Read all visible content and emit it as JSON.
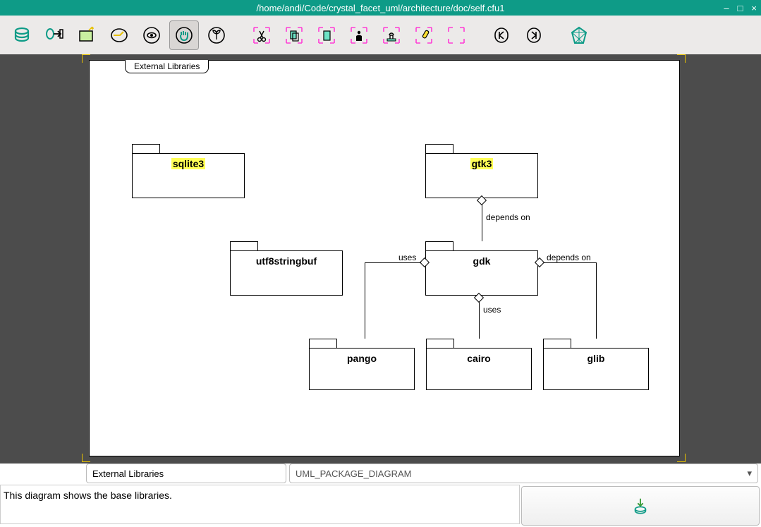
{
  "window": {
    "title": "/home/andi/Code/crystal_facet_uml/architecture/doc/self.cfu1"
  },
  "toolbar": {
    "items": [
      "database",
      "export",
      "new-window",
      "open",
      "view",
      "hand",
      "sprout",
      "cut",
      "copy",
      "paste",
      "actor",
      "stamp",
      "highlight",
      "select-area",
      "undo",
      "redo",
      "about"
    ]
  },
  "diagram": {
    "title_tab": "External Libraries",
    "packages": {
      "sqlite3": {
        "label": "sqlite3",
        "highlighted": true
      },
      "gtk3": {
        "label": "gtk3",
        "highlighted": true
      },
      "utf8stringbuf": {
        "label": "utf8stringbuf",
        "highlighted": false
      },
      "gdk": {
        "label": "gdk",
        "highlighted": false
      },
      "pango": {
        "label": "pango",
        "highlighted": false
      },
      "cairo": {
        "label": "cairo",
        "highlighted": false
      },
      "glib": {
        "label": "glib",
        "highlighted": false
      }
    },
    "connections": {
      "gtk3_gdk": {
        "label": "depends on"
      },
      "gdk_pango": {
        "label": "uses"
      },
      "gdk_cairo": {
        "label": "uses"
      },
      "gdk_glib": {
        "label": "depends on"
      }
    }
  },
  "editor": {
    "name_value": "External Libraries",
    "type_value": "UML_PACKAGE_DIAGRAM",
    "description_value": "This diagram shows the base libraries."
  },
  "colors": {
    "accent": "#0e9b87",
    "highlight": "#ffff55",
    "pink": "#ff3dd6"
  }
}
